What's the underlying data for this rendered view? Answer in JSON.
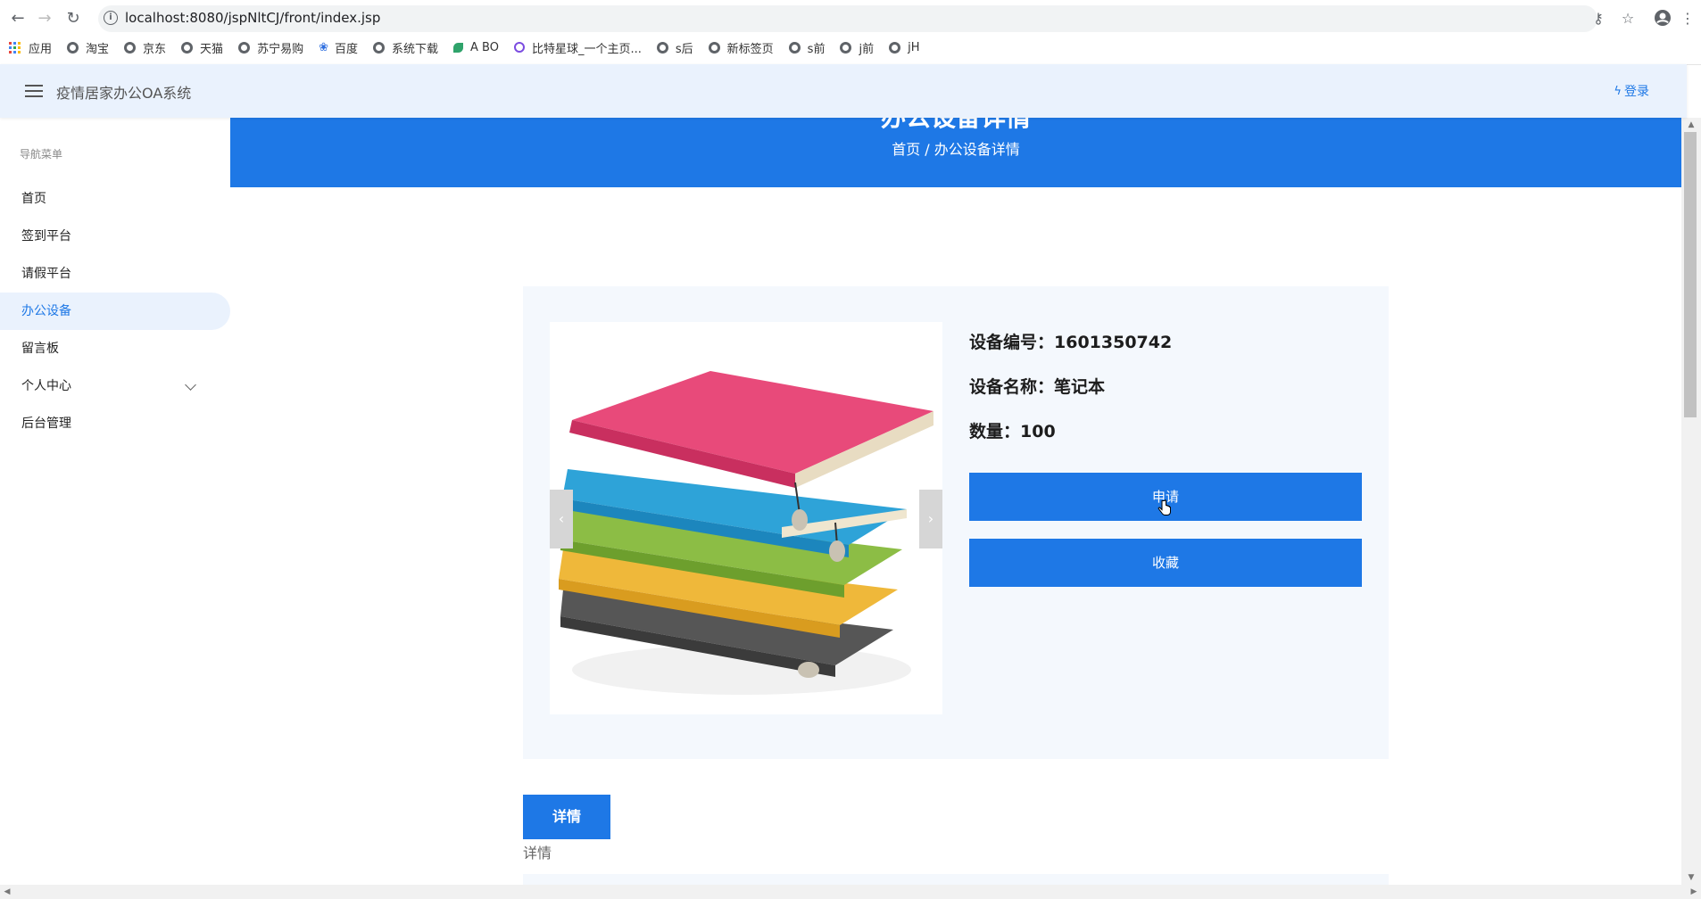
{
  "browser": {
    "url": "localhost:8080/jspNltCJ/front/index.jsp",
    "bookmarks": [
      {
        "label": "应用",
        "icon": "apps-grid-icon"
      },
      {
        "label": "淘宝",
        "icon": "globe-icon"
      },
      {
        "label": "京东",
        "icon": "globe-icon"
      },
      {
        "label": "天猫",
        "icon": "globe-icon"
      },
      {
        "label": "苏宁易购",
        "icon": "globe-icon"
      },
      {
        "label": "百度",
        "icon": "baidu-paw-icon"
      },
      {
        "label": "系统下载",
        "icon": "globe-icon"
      },
      {
        "label": "A BO",
        "icon": "leaf-icon"
      },
      {
        "label": "比特星球_一个主页...",
        "icon": "planet-icon"
      },
      {
        "label": "s后",
        "icon": "globe-icon"
      },
      {
        "label": "新标签页",
        "icon": "globe-icon"
      },
      {
        "label": "s前",
        "icon": "globe-icon"
      },
      {
        "label": "j前",
        "icon": "globe-icon"
      },
      {
        "label": "jH",
        "icon": "globe-icon"
      }
    ]
  },
  "header": {
    "app_title": "疫情居家办公OA系统",
    "login_label": "登录"
  },
  "sidebar": {
    "caption": "导航菜单",
    "items": [
      {
        "label": "首页",
        "active": false
      },
      {
        "label": "签到平台",
        "active": false
      },
      {
        "label": "请假平台",
        "active": false
      },
      {
        "label": "办公设备",
        "active": true
      },
      {
        "label": "留言板",
        "active": false
      },
      {
        "label": "个人中心",
        "active": false,
        "has_submenu": true
      },
      {
        "label": "后台管理",
        "active": false
      }
    ]
  },
  "banner": {
    "title": "办公设备详情",
    "breadcrumb": "首页 / 办公设备详情"
  },
  "detail": {
    "code_line": "设备编号：1601350742",
    "name_line": "设备名称：笔记本",
    "qty_line": "数量：100",
    "apply_label": "申请",
    "favorite_label": "收藏",
    "image_alt": "stacked colorful notebooks"
  },
  "tabs": {
    "tab_label": "详情",
    "content": "详情"
  },
  "colors": {
    "accent": "#1e78e6",
    "header_bg": "#eaf2fd",
    "card_bg": "#f4f8fd"
  }
}
